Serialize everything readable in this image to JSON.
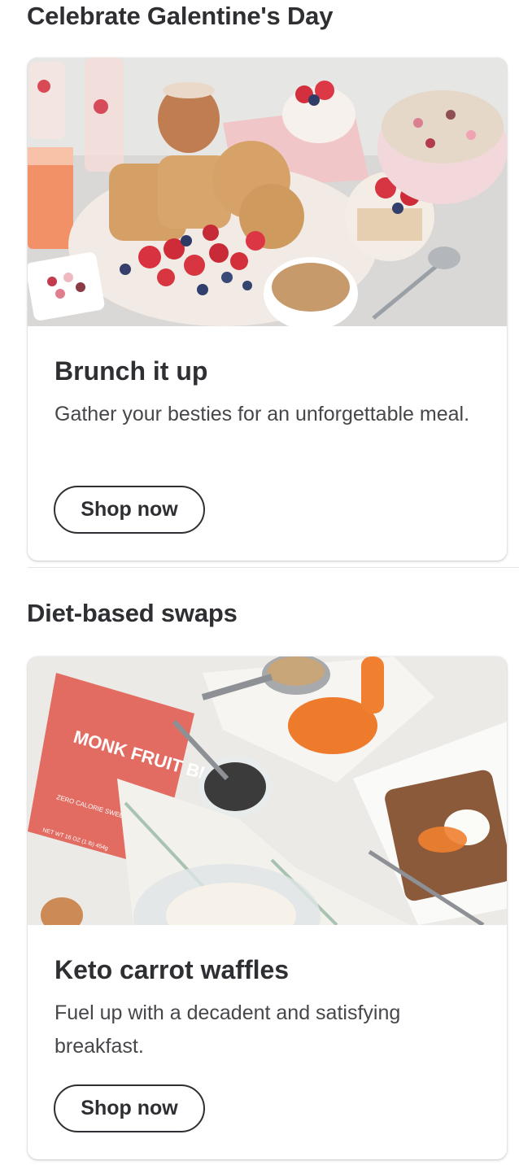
{
  "sections": [
    {
      "title": "Celebrate Galentine's Day",
      "card": {
        "image_icon": "brunch-photo",
        "title": "Brunch it up",
        "description": "Gather your besties for an unforgettable meal.",
        "button_label": "Shop now"
      }
    },
    {
      "title": "Diet-based swaps",
      "card": {
        "image_icon": "keto-waffles-photo",
        "image_text": {
          "brand": "MONK FRUIT BLEND",
          "tagline": "ZERO CALORIE SWEETENER",
          "weight": "NET WT 16 OZ (1 lb) 454g"
        },
        "title": "Keto carrot waffles",
        "description": "Fuel up with a decadent and satisfying breakfast.",
        "button_label": "Shop now"
      }
    }
  ],
  "colors": {
    "text_primary": "#2e2f32",
    "text_secondary": "#46474a",
    "divider": "#e3e4e5",
    "background": "#ffffff"
  }
}
